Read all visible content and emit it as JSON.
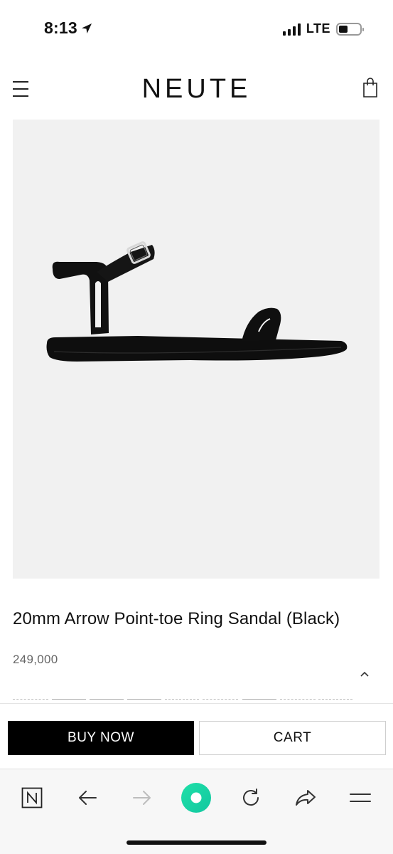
{
  "status_bar": {
    "time": "8:13",
    "network": "LTE",
    "location_icon": "location-arrow-icon"
  },
  "header": {
    "logo": "NEUTE",
    "menu_icon": "hamburger-menu-icon",
    "cart_icon": "shopping-bag-icon"
  },
  "product": {
    "title": "20mm Arrow Point-toe Ring Sandal (Black)",
    "price": "249,000",
    "image_icon": "black-sandal-image",
    "collapse_icon": "chevron-up-icon"
  },
  "actions": {
    "buy_now": "BUY NOW",
    "cart": "CART"
  },
  "browser_toolbar": {
    "items": [
      "n-app-icon",
      "back-arrow-icon",
      "forward-arrow-icon",
      "assistant-ring-icon",
      "reload-icon",
      "share-icon",
      "menu-icon"
    ]
  },
  "colors": {
    "accent": "#1fd6a2",
    "buy_button": "#000000",
    "image_background": "#f1f1f1"
  }
}
